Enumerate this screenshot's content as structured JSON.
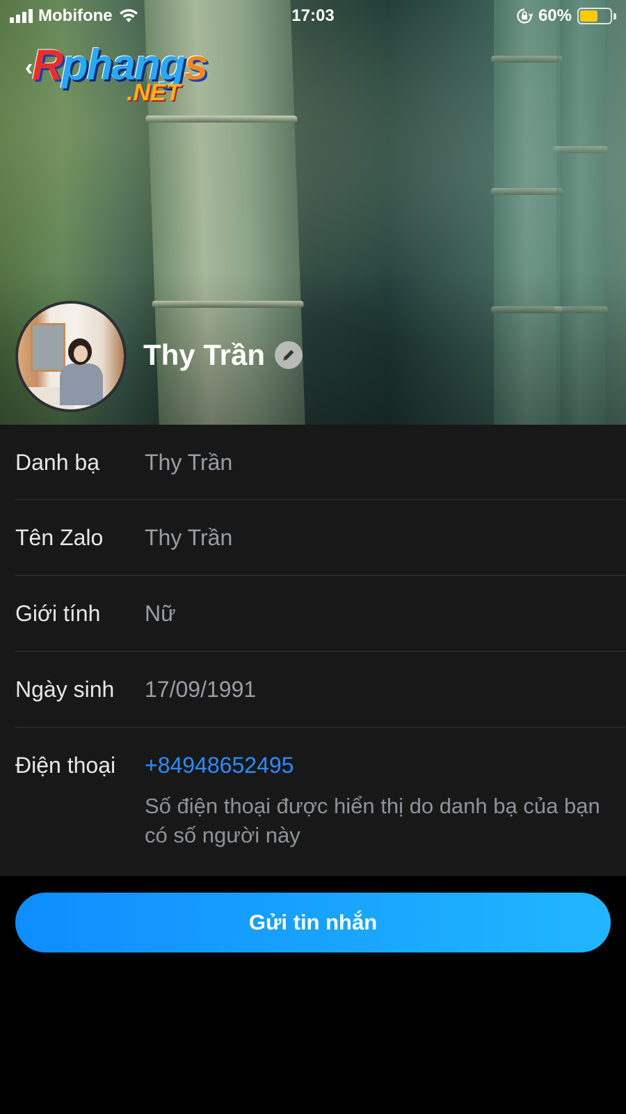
{
  "status_bar": {
    "carrier": "Mobifone",
    "time": "17:03",
    "battery_percent": "60%",
    "battery_level": 0.6
  },
  "watermark": {
    "brand_part1": "R",
    "brand_part2": "phang",
    "brand_part3": "s",
    "domain": ".NET"
  },
  "profile": {
    "name": "Thy Trần"
  },
  "details": [
    {
      "label": "Danh bạ",
      "value": "Thy Trần"
    },
    {
      "label": "Tên Zalo",
      "value": "Thy Trần"
    },
    {
      "label": "Giới tính",
      "value": "Nữ"
    },
    {
      "label": "Ngày sinh",
      "value": "17/09/1991"
    },
    {
      "label": "Điện thoại",
      "value": "+84948652495",
      "note": "Số điện thoại được hiển thị do danh bạ của bạn có số người này"
    }
  ],
  "actions": {
    "send_message": "Gửi tin nhắn"
  },
  "colors": {
    "accent": "#1a9bff",
    "link": "#2b8cff",
    "battery": "#ffcc00",
    "panel": "#181818"
  }
}
